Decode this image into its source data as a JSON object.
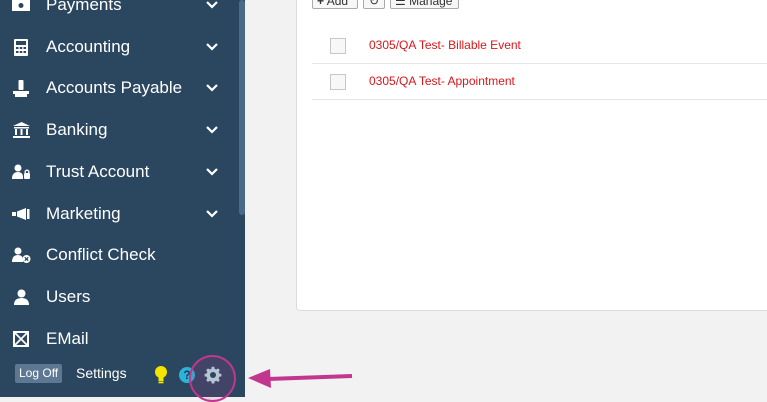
{
  "sidebar": {
    "items": [
      {
        "label": "Payments",
        "icon": "payments-icon"
      },
      {
        "label": "Accounting",
        "icon": "calculator-icon"
      },
      {
        "label": "Accounts Payable",
        "icon": "accounts-payable-icon"
      },
      {
        "label": "Banking",
        "icon": "bank-icon"
      },
      {
        "label": "Trust Account",
        "icon": "trust-account-icon"
      },
      {
        "label": "Marketing",
        "icon": "bullhorn-icon"
      },
      {
        "label": "Conflict Check",
        "icon": "conflict-check-icon"
      },
      {
        "label": "Users",
        "icon": "user-icon"
      },
      {
        "label": "EMail",
        "icon": "email-icon"
      }
    ],
    "footer": {
      "logoff_label": "Log Off",
      "settings_label": "Settings",
      "help_glyph": "?"
    }
  },
  "toolbar": {
    "add_label": "Add",
    "manage_label": "Manage"
  },
  "list": {
    "rows": [
      {
        "title": "0305/QA Test- Billable Event"
      },
      {
        "title": "0305/QA Test- Appointment"
      }
    ]
  },
  "colors": {
    "sidebar_bg": "#2b4760",
    "link_red": "#d9161b",
    "highlight": "#c2368e",
    "bulb": "#f5e400",
    "help": "#2bb4d6"
  }
}
